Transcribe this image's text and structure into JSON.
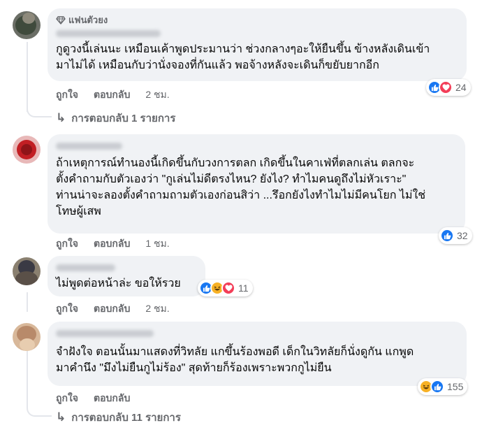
{
  "comments": [
    {
      "badge": "แฟนตัวยง",
      "text": "กูดูวงนี้เล่นนะ เหมือนเค้าพูดประมานว่า ช่วงกลางๆอะให้ยืนขึ้น ข้างหลังเดินเข้า\nมาไม่ได้ เหมือนกับว่านั่งจองที่กันแล้ว พอจ้างหลังจะเดินก็ขยับยากอีก",
      "like_label": "ถูกใจ",
      "reply_label": "ตอบกลับ",
      "time": "2 ชม.",
      "reactions": [
        "like",
        "love"
      ],
      "reaction_count": "24",
      "replies_label": "การตอบกลับ 1 รายการ"
    },
    {
      "text": "ถ้าเหตุการณ์ทำนองนี้เกิดขึ้นกับวงการตลก เกิดขึ้นในคาเฟ่ที่ตลกเล่น ตลกจะ\nตั้งคำถามกับตัวเองว่า \"กูเล่นไม่ดีตรงไหน? ยังไง? ทำไมคนดูถึงไม่หัวเราะ\"\nท่านน่าจะลองตั้งคำถามถามตัวเองก่อนสิว่า ...รึอกยังไงทำไมไม่มีคนโยก ไม่ใช่\nโทษผู้เสพ",
      "like_label": "ถูกใจ",
      "reply_label": "ตอบกลับ",
      "time": "1 ชม.",
      "reactions": [
        "like"
      ],
      "reaction_count": "32"
    },
    {
      "text": "ไม่พูดต่อหน้าล่ะ ขอให้รวย",
      "like_label": "ถูกใจ",
      "reply_label": "ตอบกลับ",
      "time": "2 ชม.",
      "reactions": [
        "like",
        "haha",
        "love"
      ],
      "reaction_count": "11"
    },
    {
      "text": "จำฝังใจ ตอนนั้นมาแสดงที่วิทลัย แกขึ้นร้องพอดี เด็กในวิทลัยก็นั่งดูกัน แกพูด\nมาคำนึง \"มึงไม่ยืนกูไม่ร้อง\" สุดท้ายก็ร้องเพราะพวกกูไม่ยืน",
      "like_label": "ถูกใจ",
      "reply_label": "ตอบกลับ",
      "time": "",
      "reactions": [
        "haha",
        "like"
      ],
      "reaction_count": "155",
      "replies_label": "การตอบกลับ 11 รายการ"
    }
  ],
  "colors": {
    "bubble_bg": "#f0f2f5",
    "secondary_text": "#65676b",
    "like_blue": "#1877f2",
    "love_red": "#f33e58",
    "haha_yellow": "#f7b125"
  }
}
